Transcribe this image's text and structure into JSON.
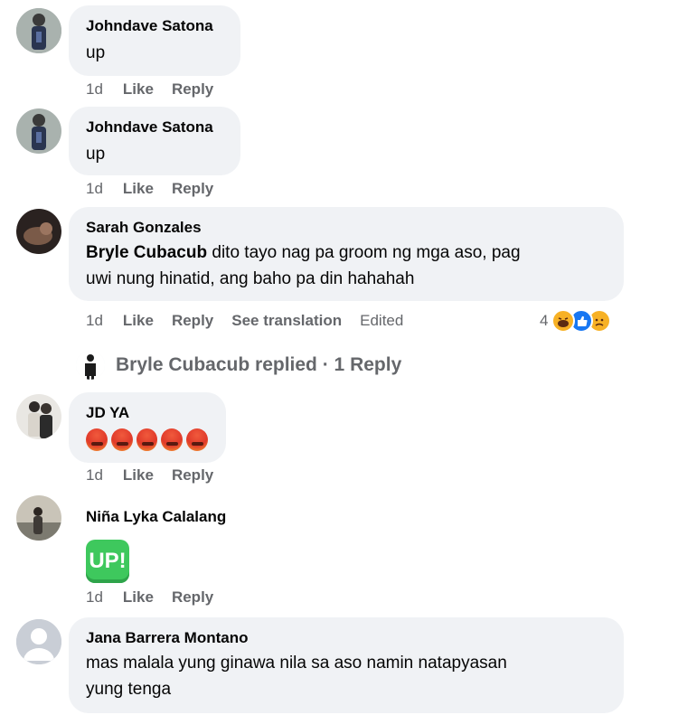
{
  "comments": [
    {
      "author": "Johndave Satona",
      "text": "up",
      "time": "1d",
      "like": "Like",
      "reply": "Reply"
    },
    {
      "author": "Johndave Satona",
      "text": "up",
      "time": "1d",
      "like": "Like",
      "reply": "Reply"
    },
    {
      "author": "Sarah Gonzales",
      "mention": "Bryle Cubacub",
      "text_line1": " dito tayo nag pa groom ng mga aso, pag",
      "text_line2": "uwi nung hinatid, ang baho pa din hahahah",
      "time": "1d",
      "like": "Like",
      "reply": "Reply",
      "see_translation": "See translation",
      "edited": "Edited",
      "reaction_count": "4"
    },
    {
      "author": "JD YA",
      "time": "1d",
      "like": "Like",
      "reply": "Reply"
    },
    {
      "author": "Niña Lyka Calalang",
      "sticker_text": "UP!",
      "time": "1d",
      "like": "Like",
      "reply": "Reply"
    },
    {
      "author": "Jana Barrera Montano",
      "text_line1": "mas malala yung ginawa nila sa aso namin natapyasan",
      "text_line2": "yung tenga"
    }
  ],
  "replies_link": "Bryle Cubacub replied · 1 Reply",
  "icons": {
    "reaction_haha": "haha-icon",
    "reaction_like": "like-icon",
    "reaction_sad": "sad-icon",
    "emoji": "angry-emoji"
  }
}
